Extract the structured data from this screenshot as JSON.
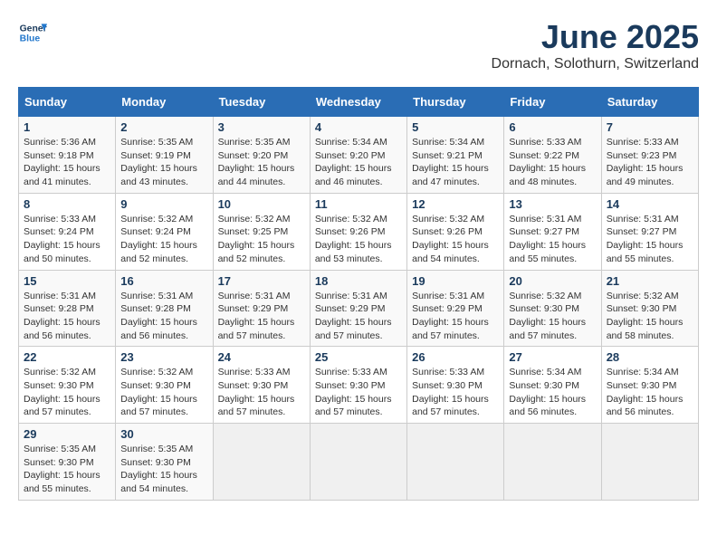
{
  "logo": {
    "text_general": "General",
    "text_blue": "Blue"
  },
  "header": {
    "title": "June 2025",
    "subtitle": "Dornach, Solothurn, Switzerland"
  },
  "weekdays": [
    "Sunday",
    "Monday",
    "Tuesday",
    "Wednesday",
    "Thursday",
    "Friday",
    "Saturday"
  ],
  "weeks": [
    [
      {
        "day": "1",
        "sunrise": "5:36 AM",
        "sunset": "9:18 PM",
        "daylight": "15 hours and 41 minutes."
      },
      {
        "day": "2",
        "sunrise": "5:35 AM",
        "sunset": "9:19 PM",
        "daylight": "15 hours and 43 minutes."
      },
      {
        "day": "3",
        "sunrise": "5:35 AM",
        "sunset": "9:20 PM",
        "daylight": "15 hours and 44 minutes."
      },
      {
        "day": "4",
        "sunrise": "5:34 AM",
        "sunset": "9:20 PM",
        "daylight": "15 hours and 46 minutes."
      },
      {
        "day": "5",
        "sunrise": "5:34 AM",
        "sunset": "9:21 PM",
        "daylight": "15 hours and 47 minutes."
      },
      {
        "day": "6",
        "sunrise": "5:33 AM",
        "sunset": "9:22 PM",
        "daylight": "15 hours and 48 minutes."
      },
      {
        "day": "7",
        "sunrise": "5:33 AM",
        "sunset": "9:23 PM",
        "daylight": "15 hours and 49 minutes."
      }
    ],
    [
      {
        "day": "8",
        "sunrise": "5:33 AM",
        "sunset": "9:24 PM",
        "daylight": "15 hours and 50 minutes."
      },
      {
        "day": "9",
        "sunrise": "5:32 AM",
        "sunset": "9:24 PM",
        "daylight": "15 hours and 52 minutes."
      },
      {
        "day": "10",
        "sunrise": "5:32 AM",
        "sunset": "9:25 PM",
        "daylight": "15 hours and 52 minutes."
      },
      {
        "day": "11",
        "sunrise": "5:32 AM",
        "sunset": "9:26 PM",
        "daylight": "15 hours and 53 minutes."
      },
      {
        "day": "12",
        "sunrise": "5:32 AM",
        "sunset": "9:26 PM",
        "daylight": "15 hours and 54 minutes."
      },
      {
        "day": "13",
        "sunrise": "5:31 AM",
        "sunset": "9:27 PM",
        "daylight": "15 hours and 55 minutes."
      },
      {
        "day": "14",
        "sunrise": "5:31 AM",
        "sunset": "9:27 PM",
        "daylight": "15 hours and 55 minutes."
      }
    ],
    [
      {
        "day": "15",
        "sunrise": "5:31 AM",
        "sunset": "9:28 PM",
        "daylight": "15 hours and 56 minutes."
      },
      {
        "day": "16",
        "sunrise": "5:31 AM",
        "sunset": "9:28 PM",
        "daylight": "15 hours and 56 minutes."
      },
      {
        "day": "17",
        "sunrise": "5:31 AM",
        "sunset": "9:29 PM",
        "daylight": "15 hours and 57 minutes."
      },
      {
        "day": "18",
        "sunrise": "5:31 AM",
        "sunset": "9:29 PM",
        "daylight": "15 hours and 57 minutes."
      },
      {
        "day": "19",
        "sunrise": "5:31 AM",
        "sunset": "9:29 PM",
        "daylight": "15 hours and 57 minutes."
      },
      {
        "day": "20",
        "sunrise": "5:32 AM",
        "sunset": "9:30 PM",
        "daylight": "15 hours and 57 minutes."
      },
      {
        "day": "21",
        "sunrise": "5:32 AM",
        "sunset": "9:30 PM",
        "daylight": "15 hours and 58 minutes."
      }
    ],
    [
      {
        "day": "22",
        "sunrise": "5:32 AM",
        "sunset": "9:30 PM",
        "daylight": "15 hours and 57 minutes."
      },
      {
        "day": "23",
        "sunrise": "5:32 AM",
        "sunset": "9:30 PM",
        "daylight": "15 hours and 57 minutes."
      },
      {
        "day": "24",
        "sunrise": "5:33 AM",
        "sunset": "9:30 PM",
        "daylight": "15 hours and 57 minutes."
      },
      {
        "day": "25",
        "sunrise": "5:33 AM",
        "sunset": "9:30 PM",
        "daylight": "15 hours and 57 minutes."
      },
      {
        "day": "26",
        "sunrise": "5:33 AM",
        "sunset": "9:30 PM",
        "daylight": "15 hours and 57 minutes."
      },
      {
        "day": "27",
        "sunrise": "5:34 AM",
        "sunset": "9:30 PM",
        "daylight": "15 hours and 56 minutes."
      },
      {
        "day": "28",
        "sunrise": "5:34 AM",
        "sunset": "9:30 PM",
        "daylight": "15 hours and 56 minutes."
      }
    ],
    [
      {
        "day": "29",
        "sunrise": "5:35 AM",
        "sunset": "9:30 PM",
        "daylight": "15 hours and 55 minutes."
      },
      {
        "day": "30",
        "sunrise": "5:35 AM",
        "sunset": "9:30 PM",
        "daylight": "15 hours and 54 minutes."
      },
      {
        "day": "",
        "sunrise": "",
        "sunset": "",
        "daylight": ""
      },
      {
        "day": "",
        "sunrise": "",
        "sunset": "",
        "daylight": ""
      },
      {
        "day": "",
        "sunrise": "",
        "sunset": "",
        "daylight": ""
      },
      {
        "day": "",
        "sunrise": "",
        "sunset": "",
        "daylight": ""
      },
      {
        "day": "",
        "sunrise": "",
        "sunset": "",
        "daylight": ""
      }
    ]
  ]
}
